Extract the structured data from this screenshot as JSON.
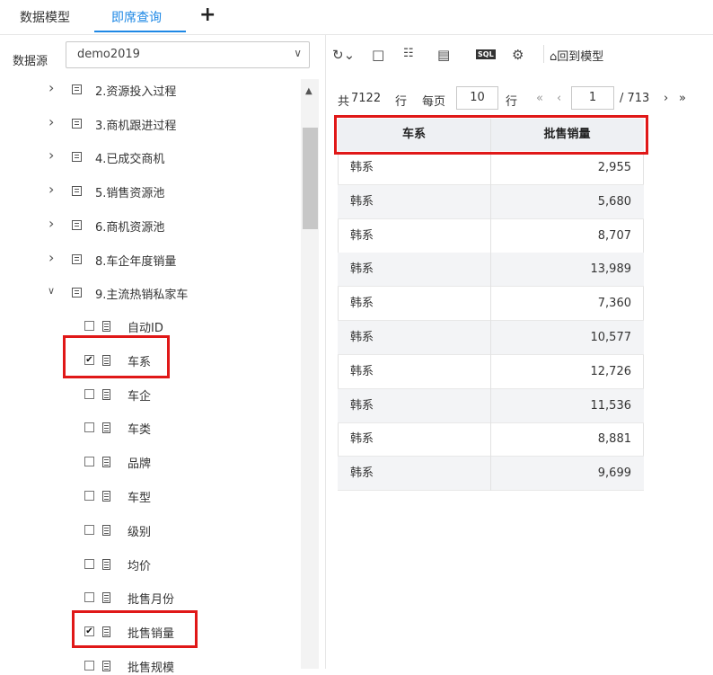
{
  "tabs": [
    {
      "label": "数据模型",
      "active": false
    },
    {
      "label": "即席查询",
      "active": true
    }
  ],
  "add_tab_icon": "plus-icon",
  "datasource": {
    "label": "数据源",
    "value": "demo2019"
  },
  "tree": {
    "tables": [
      {
        "label": "2.资源投入过程",
        "expanded": false
      },
      {
        "label": "3.商机跟进过程",
        "expanded": false
      },
      {
        "label": "4.已成交商机",
        "expanded": false
      },
      {
        "label": "5.销售资源池",
        "expanded": false
      },
      {
        "label": "6.商机资源池",
        "expanded": false
      },
      {
        "label": "8.车企年度销量",
        "expanded": false
      },
      {
        "label": "9.主流热销私家车",
        "expanded": true
      }
    ],
    "fields": [
      {
        "label": "自动ID",
        "checked": false
      },
      {
        "label": "车系",
        "checked": true
      },
      {
        "label": "车企",
        "checked": false
      },
      {
        "label": "车类",
        "checked": false
      },
      {
        "label": "品牌",
        "checked": false
      },
      {
        "label": "车型",
        "checked": false
      },
      {
        "label": "级别",
        "checked": false
      },
      {
        "label": "均价",
        "checked": false
      },
      {
        "label": "批售月份",
        "checked": false
      },
      {
        "label": "批售销量",
        "checked": true
      },
      {
        "label": "批售规模",
        "checked": false
      }
    ]
  },
  "toolbar": {
    "icons": [
      "refresh-icon",
      "save-icon",
      "tree-icon",
      "grid-icon",
      "sql-icon",
      "gear-icon"
    ],
    "sql_text": "SQL",
    "back_label": "回到模型"
  },
  "pager": {
    "total_prefix": "共",
    "total_rows": "7122",
    "rows_unit": "行",
    "per_page_label": "每页",
    "per_page": "10",
    "per_page_unit": "行",
    "current_page": "1",
    "total_pages": "/ 713"
  },
  "table": {
    "columns": [
      "车系",
      "批售销量"
    ],
    "rows": [
      [
        "韩系",
        "2,955"
      ],
      [
        "韩系",
        "5,680"
      ],
      [
        "韩系",
        "8,707"
      ],
      [
        "韩系",
        "13,989"
      ],
      [
        "韩系",
        "7,360"
      ],
      [
        "韩系",
        "10,577"
      ],
      [
        "韩系",
        "12,726"
      ],
      [
        "韩系",
        "11,536"
      ],
      [
        "韩系",
        "8,881"
      ],
      [
        "韩系",
        "9,699"
      ]
    ]
  },
  "colors": {
    "accent": "#1e88e5",
    "highlight": "#e01818"
  }
}
